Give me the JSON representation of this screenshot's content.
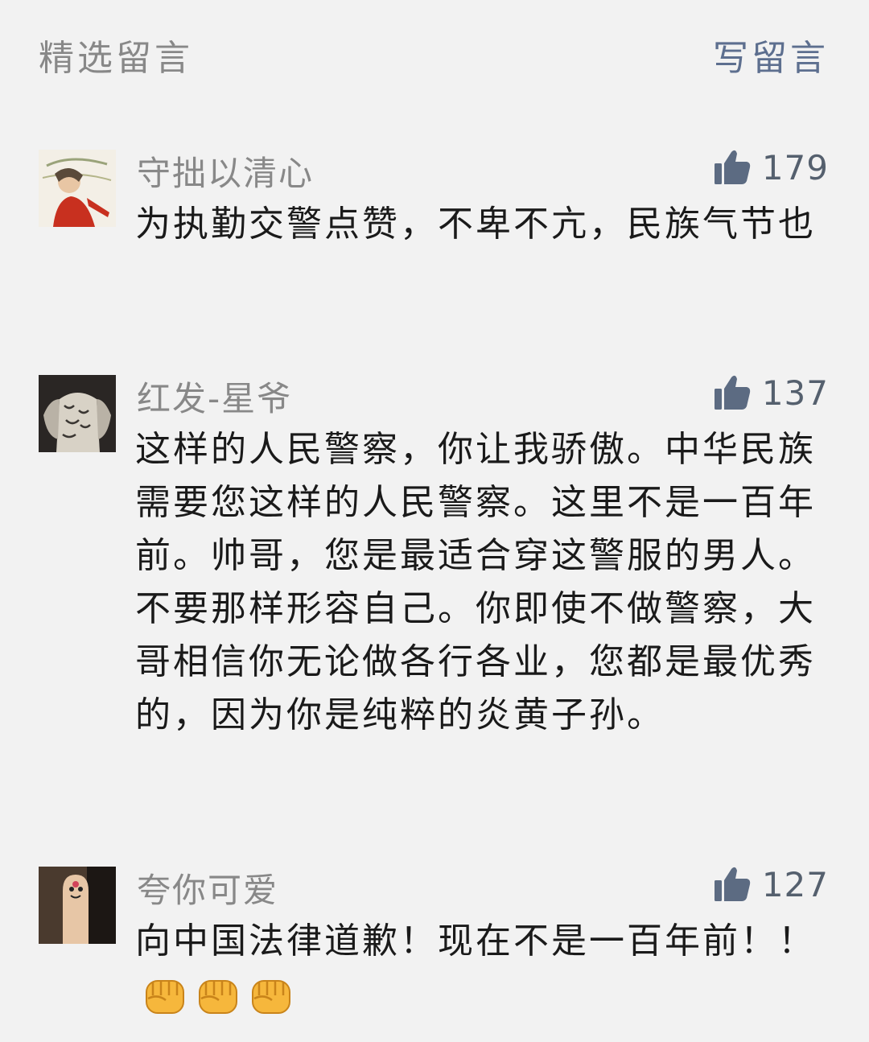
{
  "header": {
    "title": "精选留言",
    "write_label": "写留言"
  },
  "comments": [
    {
      "nickname": "守拙以清心",
      "likes": "179",
      "content": "为执勤交警点赞，不卑不亢，民族气节也"
    },
    {
      "nickname": "红发-星爷",
      "likes": "137",
      "content": "这样的人民警察，你让我骄傲。中华民族需要您这样的人民警察。这里不是一百年前。帅哥，您是最适合穿这警服的男人。不要那样形容自己。你即使不做警察，大哥相信你无论做各行各业，您都是最优秀的，因为你是纯粹的炎黄子孙。"
    },
    {
      "nickname": "夸你可爱",
      "likes": "127",
      "content": "向中国法律道歉！现在不是一百年前！！",
      "emojis": [
        "fist-emoji",
        "fist-emoji",
        "fist-emoji"
      ]
    }
  ],
  "colors": {
    "background": "#f2f2f2",
    "muted_text": "#888888",
    "link": "#5d6f8f",
    "like_icon": "#5c6b82",
    "body_text": "#1a1a1a"
  }
}
